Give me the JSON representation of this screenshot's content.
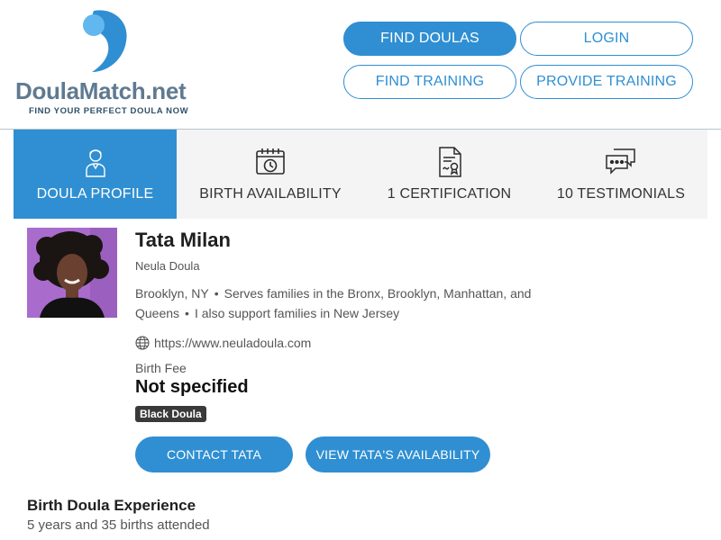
{
  "brand": {
    "logo_text_1": "Doula",
    "logo_text_2": "Match",
    "logo_text_3": ".net",
    "tagline": "FIND YOUR PERFECT DOULA NOW",
    "colors": {
      "primary": "#2f8fd2",
      "logo_light": "#62b8ee",
      "text_dark": "#1f1f1f"
    }
  },
  "header": {
    "buttons": [
      {
        "label": "FIND DOULAS",
        "style": "filled"
      },
      {
        "label": "LOGIN",
        "style": "outline"
      },
      {
        "label": "FIND TRAINING",
        "style": "outline"
      },
      {
        "label": "PROVIDE TRAINING",
        "style": "outline"
      }
    ]
  },
  "tabs": [
    {
      "label": "DOULA PROFILE",
      "icon": "person-icon",
      "active": true
    },
    {
      "label": "BIRTH AVAILABILITY",
      "icon": "calendar-clock-icon",
      "active": false
    },
    {
      "label": "1 CERTIFICATION",
      "icon": "certificate-icon",
      "active": false
    },
    {
      "label": "10 TESTIMONIALS",
      "icon": "chat-bubbles-icon",
      "active": false
    }
  ],
  "profile": {
    "name": "Tata Milan",
    "subtitle": "Neula Doula",
    "location": "Brooklyn, NY",
    "serves": "Serves families in the Bronx, Brooklyn, Manhattan, and",
    "serves_cont": "Queens",
    "extra": "I also support families in New Jersey",
    "website": "https://www.neuladoula.com",
    "fee_label": "Birth Fee",
    "fee_value": "Not specified",
    "badge": "Black Doula",
    "contact_button": "CONTACT TATA",
    "availability_button": "VIEW TATA'S AVAILABILITY"
  },
  "experience": {
    "title": "Birth Doula Experience",
    "value": "5 years and 35 births attended"
  }
}
